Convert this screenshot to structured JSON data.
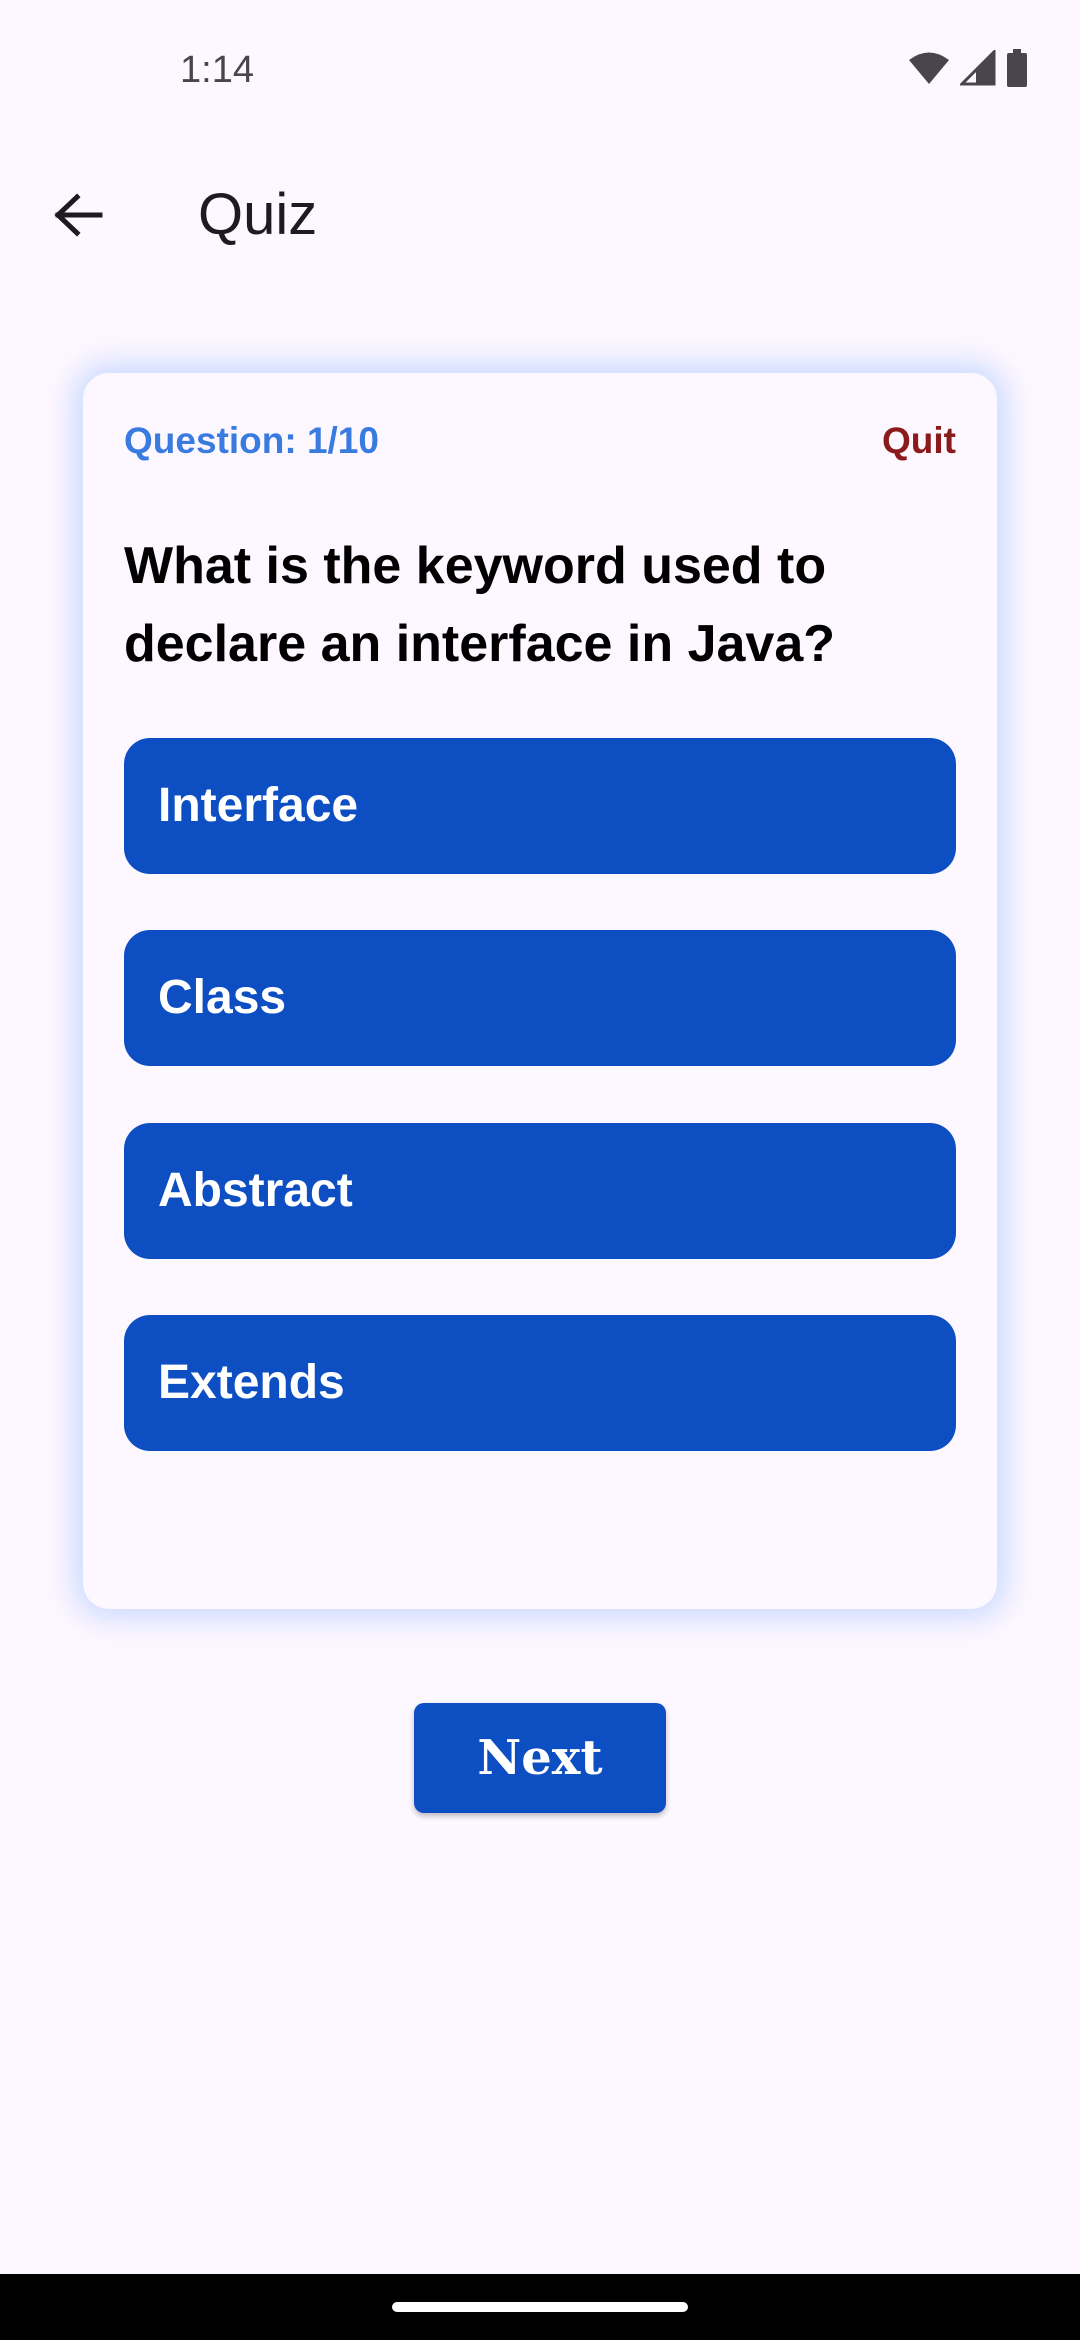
{
  "status_bar": {
    "time": "1:14",
    "icons": [
      "wifi-icon",
      "signal-icon",
      "battery-icon"
    ]
  },
  "app_bar": {
    "back_icon": "arrow-back-icon",
    "title": "Quiz"
  },
  "quiz": {
    "counter": "Question: 1/10",
    "quit_label": "Quit",
    "question": "What is the keyword used to declare an interface in Java?",
    "options": [
      "Interface",
      "Class",
      "Abstract",
      "Extends"
    ]
  },
  "next_label": "Next",
  "colors": {
    "background": "#FDF7FF",
    "primary": "#0D4FC2",
    "counter": "#3A7BE0",
    "quit": "#8B1A1A"
  }
}
